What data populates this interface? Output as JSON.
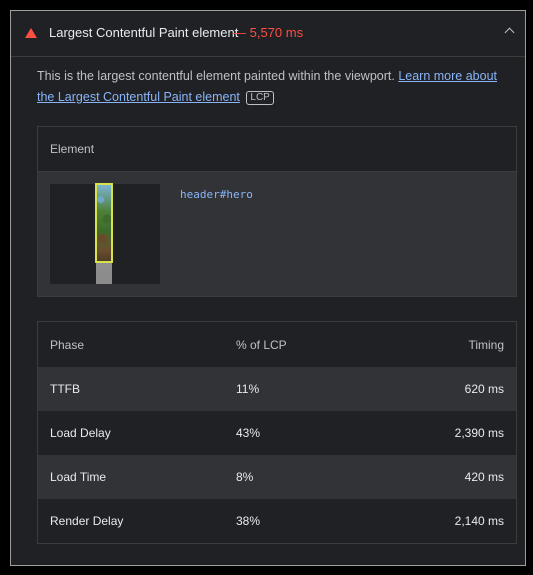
{
  "audit": {
    "title": "Largest Contentful Paint element",
    "metric": "— 5,570 ms",
    "description": "This is the largest contentful element painted within the viewport.",
    "learn_more": "Learn more about the Largest Contentful Paint element",
    "badge": "LCP",
    "status_color": "#ff4e42",
    "link_color": "#8ab4f8"
  },
  "element_table": {
    "header": "Element",
    "selector": "header#hero"
  },
  "phase_table": {
    "headers": [
      "Phase",
      "% of LCP",
      "Timing"
    ],
    "rows": [
      {
        "phase": "TTFB",
        "pct": "11%",
        "timing": "620 ms"
      },
      {
        "phase": "Load Delay",
        "pct": "43%",
        "timing": "2,390 ms"
      },
      {
        "phase": "Load Time",
        "pct": "8%",
        "timing": "420 ms"
      },
      {
        "phase": "Render Delay",
        "pct": "38%",
        "timing": "2,140 ms"
      }
    ]
  }
}
